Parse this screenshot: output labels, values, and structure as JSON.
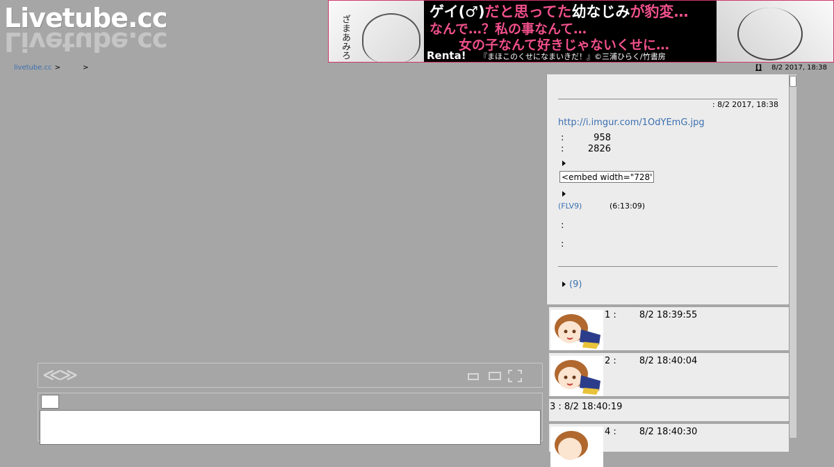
{
  "logo": {
    "text": "Livetube.cc"
  },
  "ad": {
    "line1_a": "ゲイ(♂)",
    "line1_b": "だと思ってた",
    "line1_c": "幼なじみ",
    "line1_d": "が豹変…",
    "line2": "なんで…？私の事なんて…",
    "line3": "女の子なんて好きじゃないくせに…",
    "side_text": "ざまあみろ",
    "brand": "Renta!",
    "credit": "『まほこのくせになまいきだ！』©三浦ひらく/竹書房"
  },
  "breadcrumb": {
    "home": "livetube.cc",
    "sep1": ">",
    "sep2": ">"
  },
  "topright": {
    "bracket": "[]",
    "datetime": "8/2 2017, 18:38"
  },
  "info": {
    "date": ": 8/2 2017, 18:38",
    "link": "http://i.imgur.com/1OdYEmG.jpg",
    "stat1": {
      "colon": ":",
      "value": "958"
    },
    "stat2": {
      "colon": ":",
      "value": "2826"
    },
    "embed_value": "<embed width=\"728\"",
    "flv": "(FLV9)",
    "duration": "(6:13:09)",
    "colon_a": ":",
    "colon_b": ":",
    "count": "(9)"
  },
  "comments": [
    {
      "text": "1 :        8/2 18:39:55",
      "avatar": true
    },
    {
      "text": "2 :        8/2 18:40:04",
      "avatar": true
    },
    {
      "text": "3 : 8/2 18:40:19",
      "avatar": false
    },
    {
      "text": "4 :        8/2 18:40:30",
      "avatar": true
    }
  ],
  "controls": {
    "prev": "≪",
    "next": "≫"
  },
  "colors": {
    "background": "#a6a6a6",
    "panel": "#ececec",
    "link": "#3a6fb0",
    "ad_pink": "#f0508a"
  }
}
